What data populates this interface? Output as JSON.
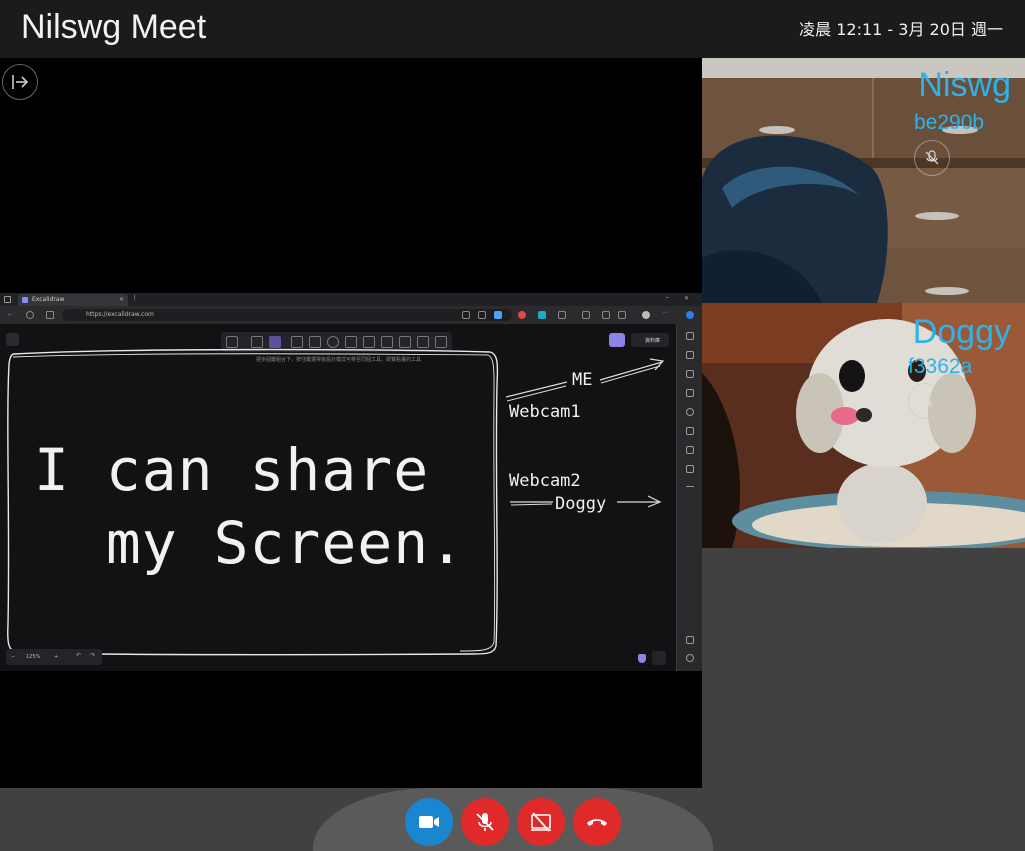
{
  "header": {
    "title": "Nilswg Meet",
    "clock": "凌晨 12:11 - 3月 20日 週一"
  },
  "shared_screen": {
    "browser": {
      "tab_title": "Excalidraw",
      "url": "https://excalidraw.com",
      "toolbar_hint": "把多個鍵組合下，按住鍵選擇後設計模式可移至同個工具，即寬點畫的工具",
      "library_label": "資料庫",
      "zoom_level": "125%"
    },
    "board_lines": [
      "I can share",
      "  my Screen."
    ],
    "annotations": {
      "me": "ME",
      "webcam1": "Webcam1",
      "webcam2": "Webcam2",
      "doggy": "Doggy"
    }
  },
  "participants": [
    {
      "name": "Niswg",
      "id": "be290b",
      "icon": "mic-off-icon"
    },
    {
      "name": "Doggy",
      "id": "f3362a",
      "icon": "mic-off-icon"
    }
  ],
  "controls": {
    "camera": {
      "icon": "video-camera-icon",
      "color": "#1a86cf"
    },
    "mic": {
      "icon": "mic-off-icon",
      "color": "#e02a2a"
    },
    "screen_share": {
      "icon": "screen-share-off-icon",
      "color": "#e02a2a"
    },
    "hangup": {
      "icon": "phone-hangup-icon",
      "color": "#e02a2a"
    }
  }
}
